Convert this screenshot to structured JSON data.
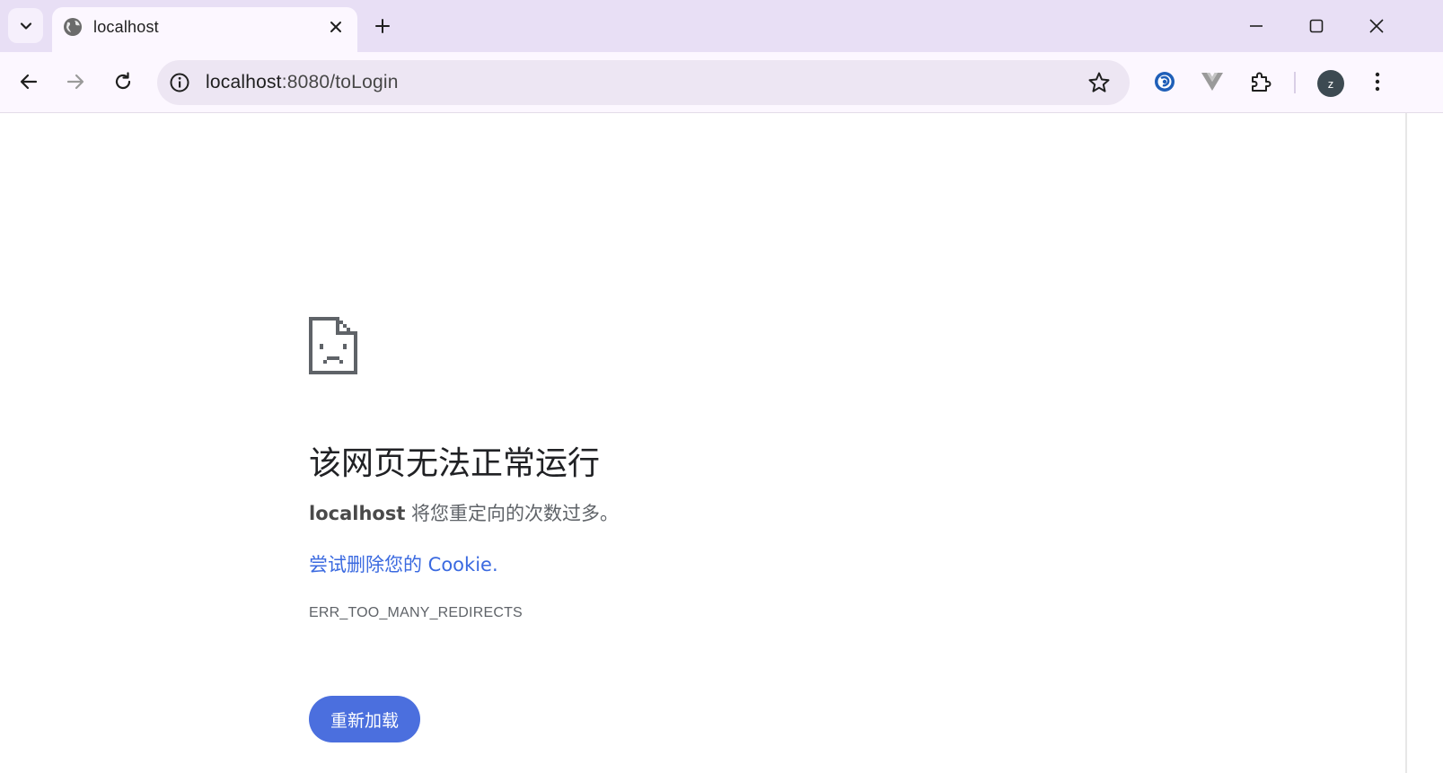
{
  "browser": {
    "tab": {
      "title": "localhost",
      "favicon": "globe-icon"
    },
    "new_tab_label": "+",
    "omnibox": {
      "host": "localhost",
      "path": ":8080/toLogin"
    },
    "profile_initial": "z",
    "accent_color": "#e8dff5"
  },
  "error_page": {
    "heading": "该网页无法正常运行",
    "summary_host": "localhost",
    "summary_text": " 将您重定向的次数过多。",
    "suggestion_link": "尝试删除您的 Cookie",
    "suggestion_suffix": ".",
    "error_code": "ERR_TOO_MANY_REDIRECTS",
    "reload_button": "重新加载",
    "button_color": "#4b6fde",
    "link_color": "#3b6ae0"
  }
}
